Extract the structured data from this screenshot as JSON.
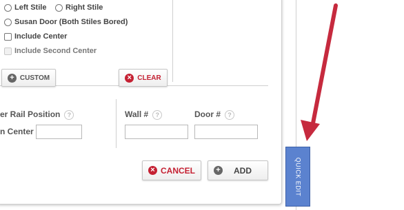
{
  "options": {
    "left_stile": "Left Stile",
    "right_stile": "Right Stile",
    "susan_door": "Susan Door (Both Stiles Bored)",
    "include_center": "Include Center",
    "include_second_center": "Include Second Center"
  },
  "buttons": {
    "custom": "CUSTOM",
    "clear": "CLEAR",
    "cancel": "CANCEL",
    "add": "ADD"
  },
  "fields": {
    "rail_position_label": "er Rail Position",
    "center_label": "n Center",
    "wall_label": "Wall #",
    "door_label": "Door #",
    "help_glyph": "?"
  },
  "side_tab": {
    "label": "QUICK EDIT"
  },
  "colors": {
    "accent_blue": "#5b82cf",
    "danger_red": "#c52133",
    "arrow_red": "#c62a3e"
  }
}
